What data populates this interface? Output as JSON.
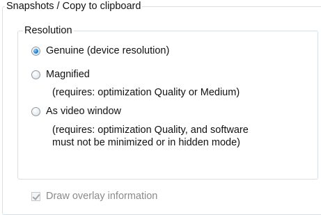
{
  "snapshots_group": {
    "title": "Snapshots / Copy to clipboard"
  },
  "resolution_group": {
    "title": "Resolution",
    "options": [
      {
        "label": "Genuine (device resolution)",
        "selected": true
      },
      {
        "label": "Magnified",
        "selected": false,
        "note_lines": [
          "(requires: optimization Quality or Medium)"
        ]
      },
      {
        "label": "As video window",
        "selected": false,
        "note_lines": [
          "(requires: optimization Quality, and software",
          "must not be minimized or in hidden mode)"
        ]
      }
    ]
  },
  "overlay_checkbox": {
    "label": "Draw overlay information",
    "checked": true,
    "enabled": false
  }
}
